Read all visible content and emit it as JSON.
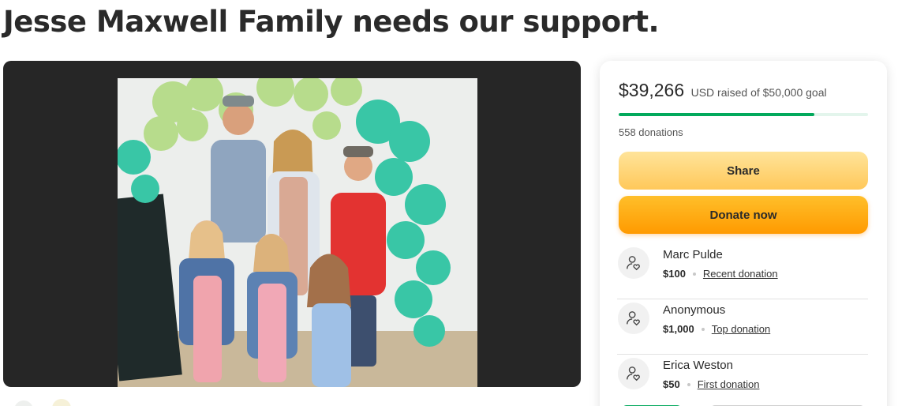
{
  "page": {
    "title": "Jesse Maxwell Family needs our support."
  },
  "media": {
    "image_description_icon": "family-photo"
  },
  "donation_card": {
    "raised_amount": "$39,266",
    "goal_text": "USD raised of $50,000 goal",
    "progress_fraction": 0.785,
    "donation_count": "558 donations",
    "share_label": "Share",
    "donate_label": "Donate now",
    "donors": [
      {
        "name": "Marc Pulde",
        "amount": "$100",
        "tag": "Recent donation"
      },
      {
        "name": "Anonymous",
        "amount": "$1,000",
        "tag": "Top donation"
      },
      {
        "name": "Erica Weston",
        "amount": "$50",
        "tag": "First donation"
      }
    ]
  },
  "colors": {
    "progress": "#02a95c",
    "share_button": "#ffd873",
    "donate_button": "#ffae12"
  }
}
